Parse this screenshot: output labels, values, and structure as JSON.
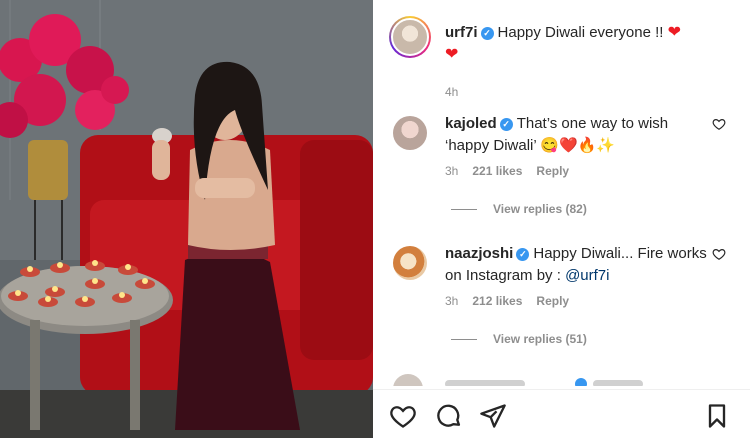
{
  "caption": {
    "username": "urf7i",
    "verified": true,
    "text": "Happy Diwali everyone !!",
    "time": "4h"
  },
  "comments": [
    {
      "username": "kajoled",
      "verified": true,
      "text": "That’s one way to wish ‘happy Diwali’",
      "emojis": "😋❤️🔥✨",
      "time": "3h",
      "likes": "221 likes",
      "reply_label": "Reply",
      "view_replies": "View replies (82)"
    },
    {
      "username": "naazjoshi",
      "verified": true,
      "text": "Happy Diwali... Fire works on Instagram by :",
      "mention": "@urf7i",
      "time": "3h",
      "likes": "212 likes",
      "reply_label": "Reply",
      "view_replies": "View replies (51)"
    }
  ],
  "icons": {
    "like": "heart-outline-icon",
    "comment": "speech-bubble-icon",
    "share": "paper-plane-icon",
    "save": "bookmark-icon",
    "comment_like": "small-heart-icon",
    "verified": "verified-badge-icon"
  },
  "colors": {
    "verified_blue": "#3897f0",
    "heart_red": "#ed1c24",
    "secondary_text": "#8e8e8e",
    "mention_blue": "#00376b"
  }
}
